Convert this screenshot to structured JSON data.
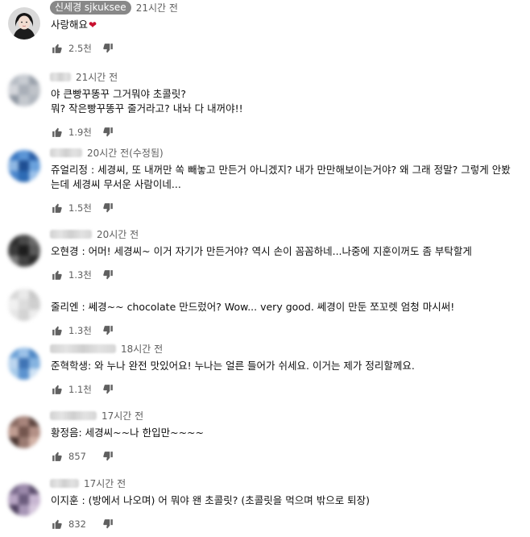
{
  "comments": [
    {
      "author": "신세경 sjkuksee",
      "author_is_creator": true,
      "time": "21시간 전",
      "lines": [
        "사랑해요"
      ],
      "has_heart": true,
      "likes": "2.5천"
    },
    {
      "author": "",
      "author_is_creator": false,
      "time": "21시간 전",
      "lines": [
        "야 큰빵꾸똥꾸 그거뭐야 초콜릿?",
        "뭐? 작은빵꾸똥꾸 줄거라고? 내놔 다 내꺼야!!"
      ],
      "has_heart": false,
      "likes": "1.9천"
    },
    {
      "author": "",
      "author_is_creator": false,
      "time": "20시간 전(수정됨)",
      "lines": [
        "쥬얼리정 : 세경씨, 또 내꺼만 쏙 빼놓고 만든거 아니겠지? 내가 만만해보이는거야? 왜 그래 정말? 그렇게 안봤",
        "는데 세경씨 무서운 사람이네..."
      ],
      "has_heart": false,
      "likes": "1.5천"
    },
    {
      "author": "",
      "author_is_creator": false,
      "time": "20시간 전",
      "lines": [
        "오현경 : 어머! 세경씨~ 이거 자기가 만든거야? 역시 손이 꼼꼼하네...나중에 지훈이꺼도 좀 부탁할게"
      ],
      "has_heart": false,
      "likes": "1.3천"
    },
    {
      "author": "",
      "author_is_creator": false,
      "time": "",
      "lines": [
        "줄리엔 : 쎄경~~ chocolate 만드렀어? Wow... very good. 쎄경이 만둔 쪼꼬렛 엄청 마시써!"
      ],
      "has_heart": false,
      "likes": "1.3천"
    },
    {
      "author": "",
      "author_is_creator": false,
      "time": "18시간 전",
      "lines": [
        "준혁학생: 와 누나 완전 맛있어요! 누나는 얼른 들어가 쉬세요. 이거는 제가 정리할께요."
      ],
      "has_heart": false,
      "likes": "1.1천"
    },
    {
      "author": "",
      "author_is_creator": false,
      "time": "17시간 전",
      "lines": [
        "황정음: 세경씨~~나 한입만~~~~"
      ],
      "has_heart": false,
      "likes": "857"
    },
    {
      "author": "",
      "author_is_creator": false,
      "time": "17시간 전",
      "lines": [
        "이지훈 : (방에서 나오며) 어 뭐야 왠 초콜릿? (초콜릿을 먹으며 밖으로 퇴장)"
      ],
      "has_heart": false,
      "likes": "832"
    }
  ],
  "icons": {
    "like": "thumbs-up-icon",
    "dislike": "thumbs-down-icon",
    "heart": "heart-icon"
  },
  "colors": {
    "text": "#0f0f0f",
    "meta": "#606060",
    "creator_chip": "#888888",
    "heart": "#c8102e"
  }
}
